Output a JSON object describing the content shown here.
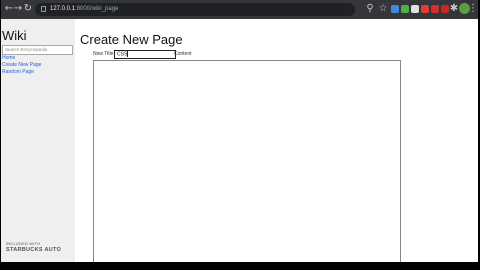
{
  "browser": {
    "url_host": "127.0.0.1",
    "url_path": ":8000/wiki_page",
    "icons": {
      "back": "arrow-left-icon",
      "forward": "arrow-right-icon",
      "reload": "reload-icon",
      "home": "home-icon",
      "lock": "lock-icon",
      "star": "star-icon",
      "menu": "kebab-menu-icon"
    }
  },
  "sidebar": {
    "title": "Wiki",
    "search_placeholder": "Search Encyclopedia",
    "links": [
      {
        "label": "Home"
      },
      {
        "label": "Create New Page"
      },
      {
        "label": "Random Page"
      }
    ]
  },
  "main": {
    "heading": "Create New Page",
    "title_label": "New Title",
    "title_value": "CSS",
    "content_label": "Content"
  },
  "footer": {
    "text": "INCLUDED WITH",
    "logo": "STARBUCKS AUTO"
  },
  "colors": {
    "toolbar_bg": "#35363a",
    "omnibox_bg": "#202124",
    "sidebar_bg": "#efefef",
    "link": "#2a60d8"
  }
}
